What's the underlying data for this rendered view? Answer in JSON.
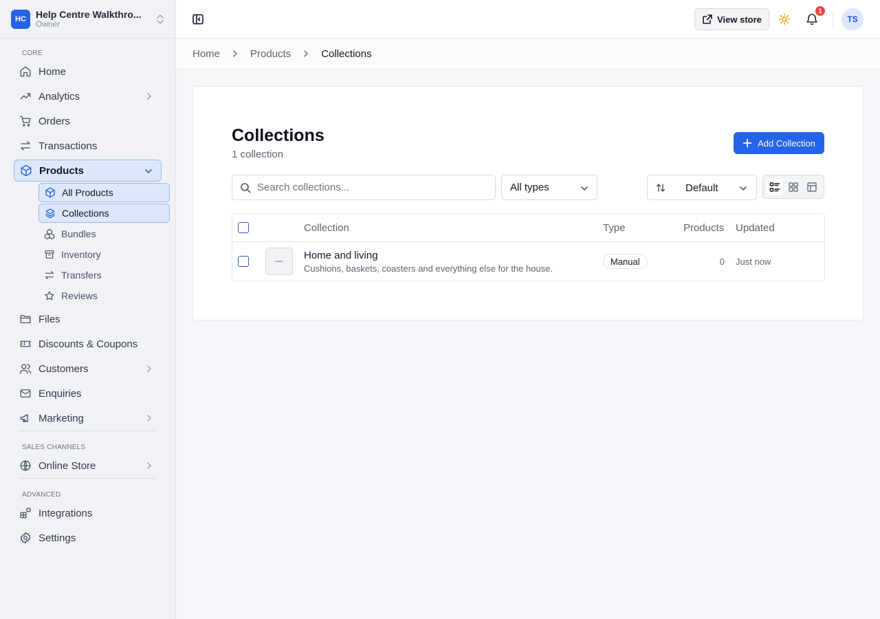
{
  "store": {
    "initials": "HC",
    "name": "Help Centre Walkthro...",
    "role": "Owner"
  },
  "sidebar": {
    "sections": {
      "core": "CORE",
      "sales": "SALES CHANNELS",
      "advanced": "ADVANCED"
    },
    "items": {
      "home": "Home",
      "analytics": "Analytics",
      "orders": "Orders",
      "transactions": "Transactions",
      "products": "Products",
      "files": "Files",
      "discounts": "Discounts & Coupons",
      "customers": "Customers",
      "enquiries": "Enquiries",
      "marketing": "Marketing",
      "online_store": "Online Store",
      "integrations": "Integrations",
      "settings": "Settings"
    },
    "product_sub": {
      "all": "All Products",
      "collections": "Collections",
      "bundles": "Bundles",
      "inventory": "Inventory",
      "transfers": "Transfers",
      "reviews": "Reviews"
    }
  },
  "header": {
    "view_store": "View store",
    "notification_count": "1",
    "avatar_initials": "TS"
  },
  "breadcrumb": {
    "home": "Home",
    "products": "Products",
    "current": "Collections"
  },
  "main": {
    "title": "Collections",
    "count": "1 collection",
    "add_button": "Add Collection",
    "search_placeholder": "Search collections...",
    "type_filter": "All types",
    "sort": "Default"
  },
  "table": {
    "headers": {
      "collection": "Collection",
      "type": "Type",
      "products": "Products",
      "updated": "Updated"
    },
    "rows": [
      {
        "name": "Home and living",
        "description": "Cushions, baskets, coasters and everything else for the house.",
        "type": "Manual",
        "products": "0",
        "updated": "Just now"
      }
    ]
  },
  "colors": {
    "accent": "#2563eb",
    "active_bg": "#dce7f9",
    "badge": "#ef4444",
    "sun": "#f59e0b"
  }
}
